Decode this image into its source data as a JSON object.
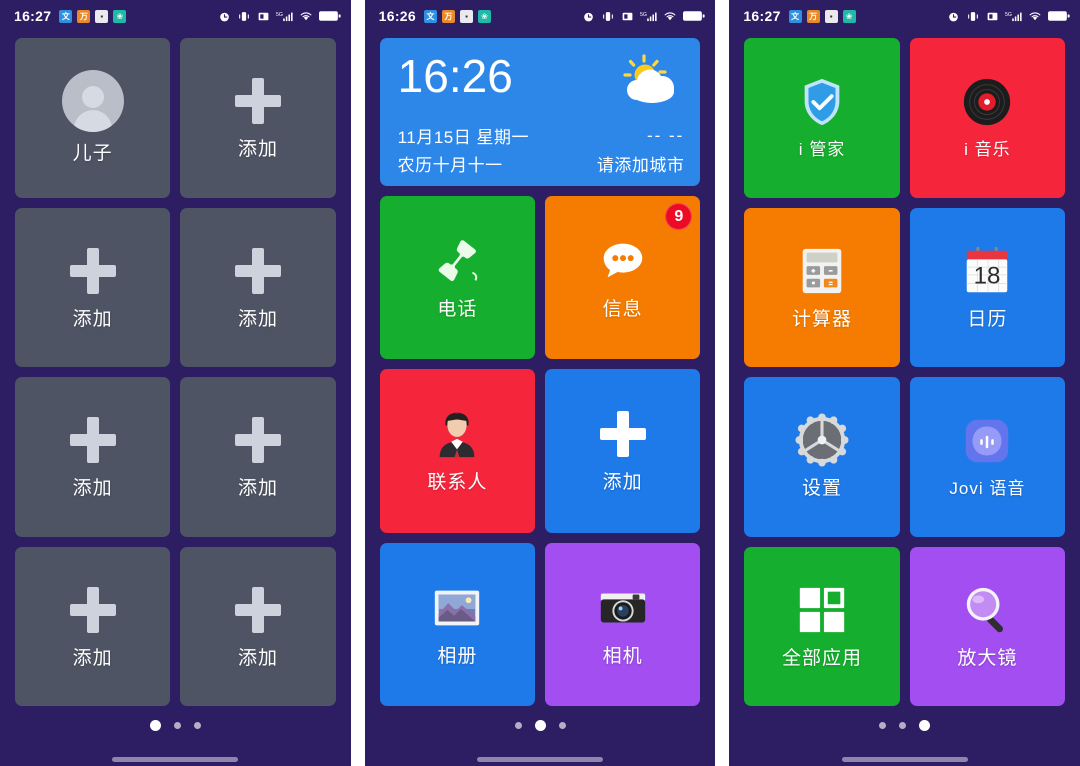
{
  "screens": [
    {
      "name": "contacts-screen",
      "statusbar": {
        "time": "16:27",
        "left_icons": [
          "app-icon-blue",
          "app-icon-orange",
          "app-icon-white",
          "app-icon-teal"
        ],
        "right_icons": [
          "alarm-icon",
          "vibrate-icon",
          "nfc-icon",
          "signal-5g-icon",
          "wifi-icon",
          "battery-icon"
        ]
      },
      "tiles": [
        {
          "label": "儿子",
          "icon": "avatar-icon",
          "style": "grey"
        },
        {
          "label": "添加",
          "icon": "plus-icon",
          "style": "grey"
        },
        {
          "label": "添加",
          "icon": "plus-icon",
          "style": "grey"
        },
        {
          "label": "添加",
          "icon": "plus-icon",
          "style": "grey"
        },
        {
          "label": "添加",
          "icon": "plus-icon",
          "style": "grey"
        },
        {
          "label": "添加",
          "icon": "plus-icon",
          "style": "grey"
        },
        {
          "label": "添加",
          "icon": "plus-icon",
          "style": "grey"
        },
        {
          "label": "添加",
          "icon": "plus-icon",
          "style": "grey"
        }
      ],
      "page_dots": {
        "count": 3,
        "active": 0
      }
    },
    {
      "name": "home-screen",
      "statusbar": {
        "time": "16:26",
        "left_icons": [
          "app-icon-blue",
          "app-icon-orange",
          "app-icon-white",
          "app-icon-teal"
        ],
        "right_icons": [
          "alarm-icon",
          "vibrate-icon",
          "nfc-icon",
          "signal-5g-icon",
          "wifi-icon",
          "battery-icon"
        ]
      },
      "weather_widget": {
        "time": "16:26",
        "date": "11月15日  星期一",
        "lunar": "农历十月十一",
        "temperature": "-- --",
        "city": "请添加城市",
        "weather_icon": "sun-behind-cloud-icon",
        "bg_color": "#2d87e8"
      },
      "tiles": [
        {
          "label": "电话",
          "icon": "phone-handset-icon",
          "style": "green"
        },
        {
          "label": "信息",
          "icon": "speech-bubble-icon",
          "style": "orange",
          "badge": "9"
        },
        {
          "label": "联系人",
          "icon": "person-suit-icon",
          "style": "crimson"
        },
        {
          "label": "添加",
          "icon": "plus-icon",
          "style": "blue"
        },
        {
          "label": "相册",
          "icon": "photo-frame-icon",
          "style": "blue"
        },
        {
          "label": "相机",
          "icon": "camera-icon",
          "style": "purple"
        }
      ],
      "page_dots": {
        "count": 3,
        "active": 1
      }
    },
    {
      "name": "apps-screen",
      "statusbar": {
        "time": "16:27",
        "left_icons": [
          "app-icon-blue",
          "app-icon-orange",
          "app-icon-white",
          "app-icon-teal"
        ],
        "right_icons": [
          "alarm-icon",
          "vibrate-icon",
          "nfc-icon",
          "signal-5g-icon",
          "wifi-icon",
          "battery-icon"
        ]
      },
      "tiles": [
        {
          "label": "i 管家",
          "icon": "shield-check-icon",
          "style": "green"
        },
        {
          "label": "i 音乐",
          "icon": "vinyl-record-icon",
          "style": "crimson"
        },
        {
          "label": "计算器",
          "icon": "calculator-icon",
          "style": "orange"
        },
        {
          "label": "日历",
          "icon": "calendar-icon",
          "style": "blue",
          "calendar_day": "18"
        },
        {
          "label": "设置",
          "icon": "gear-icon",
          "style": "blue"
        },
        {
          "label": "Jovi 语音",
          "icon": "jovi-voice-icon",
          "style": "blue"
        },
        {
          "label": "全部应用",
          "icon": "grid-squares-icon",
          "style": "green"
        },
        {
          "label": "放大镜",
          "icon": "magnifier-icon",
          "style": "purple"
        }
      ],
      "page_dots": {
        "count": 3,
        "active": 2
      }
    }
  ],
  "theme": {
    "wallpaper": "#2d1d63",
    "tile_grey": "#4e5463",
    "accent_badge": "#ee0a24"
  }
}
